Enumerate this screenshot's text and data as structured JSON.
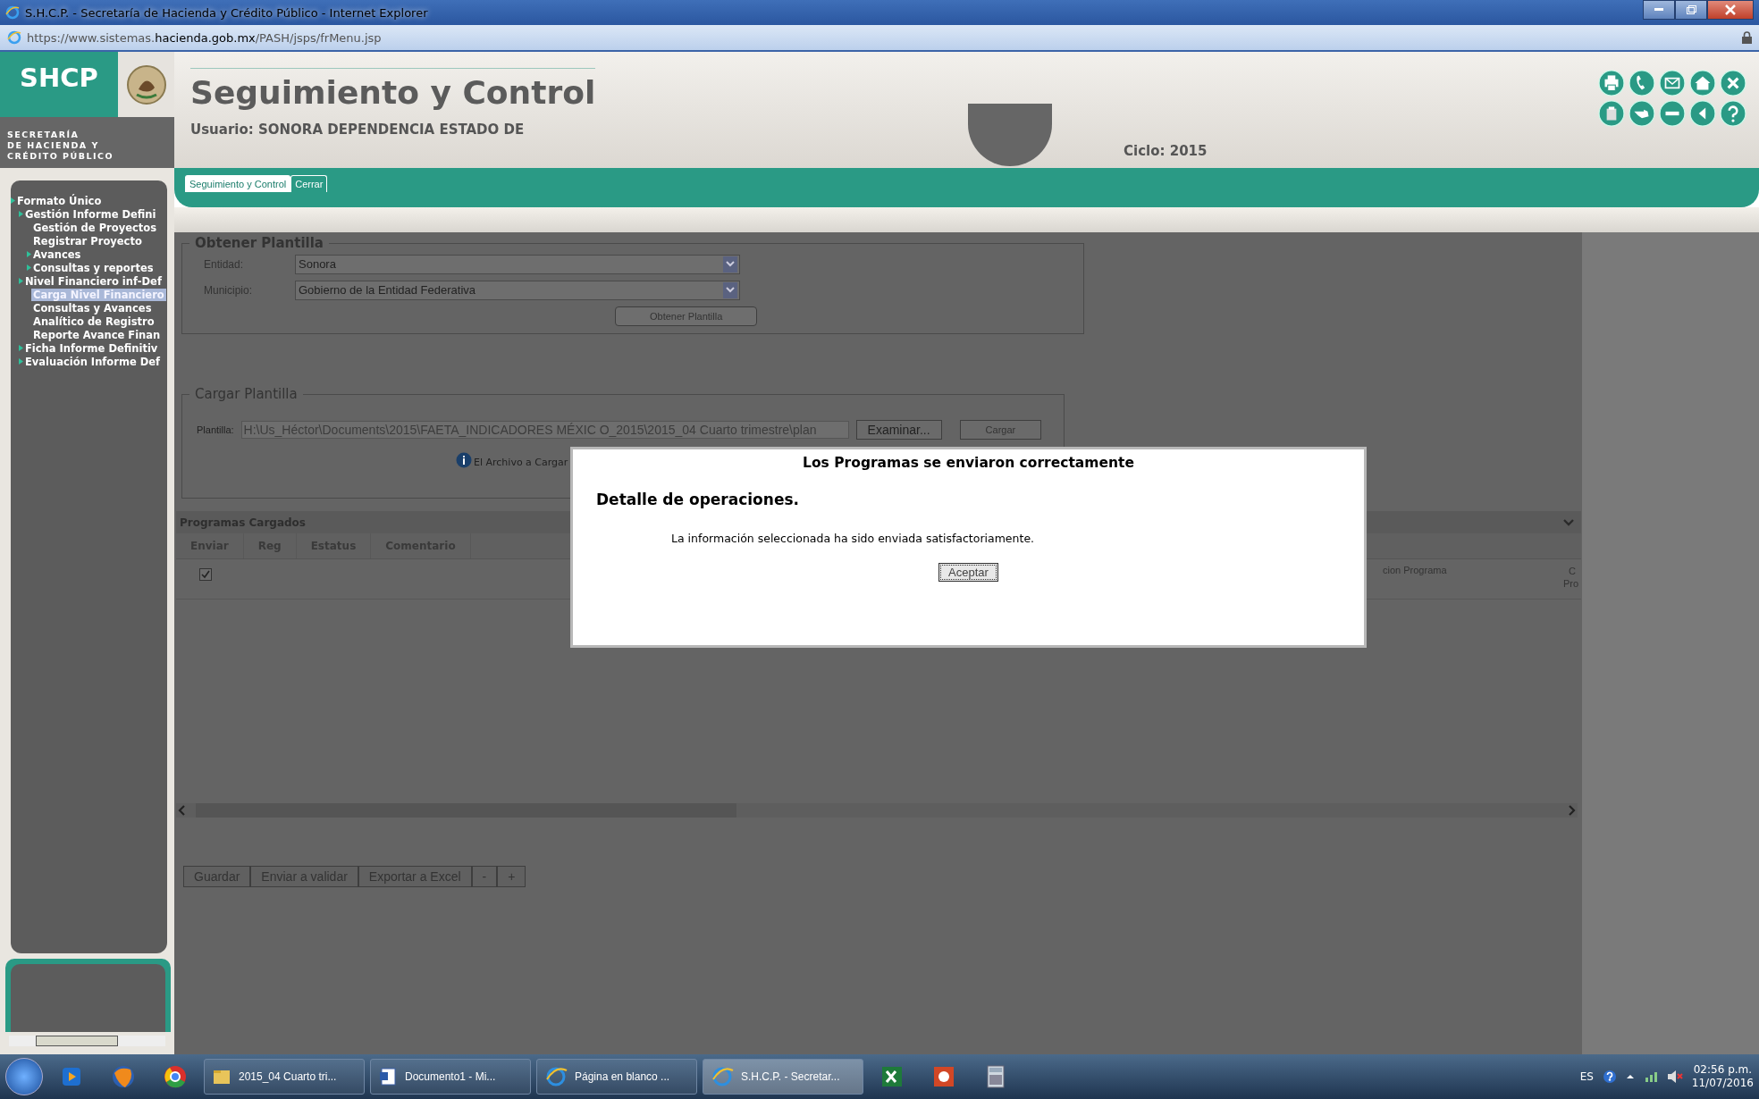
{
  "window": {
    "title": "S.H.C.P. - Secretaría de Hacienda y Crédito Público - Internet Explorer"
  },
  "address_bar": {
    "url": "https://www.sistemas.**hacienda.gob.mx**/PASH/jsps/frMenu.jsp"
  },
  "logo": {
    "acronym": "SHCP",
    "subtitle_lines": [
      "SECRETARÍA",
      "DE HACIENDA Y",
      "CRÉDITO PÚBLICO"
    ]
  },
  "header": {
    "title": "Seguimiento y Control",
    "user": "Usuario: SONORA DEPENDENCIA ESTADO DE",
    "cycle": "Ciclo: 2015"
  },
  "tabs": [
    {
      "label": "Seguimiento y Control",
      "selected": true
    },
    {
      "label": "Cerrar",
      "selected": false
    }
  ],
  "sidebar": {
    "items": [
      {
        "label": "Formato Único",
        "kind": "folder",
        "selected": false,
        "children": [
          {
            "label": "Gestión Informe Defini",
            "kind": "folder",
            "selected": false,
            "children": [
              {
                "label": "Gestión de Proyectos",
                "kind": "page",
                "selected": false
              },
              {
                "label": "Registrar Proyecto",
                "kind": "page",
                "selected": false
              },
              {
                "label": "Avances",
                "kind": "folder",
                "selected": false
              },
              {
                "label": "Consultas y reportes",
                "kind": "folder",
                "selected": false
              }
            ]
          },
          {
            "label": "Nivel Financiero inf-Def",
            "kind": "folder",
            "selected": false,
            "children": [
              {
                "label": "Carga Nivel Financiero",
                "kind": "page",
                "selected": true
              },
              {
                "label": "Consultas y Avances",
                "kind": "page",
                "selected": false
              },
              {
                "label": "Analítico de Registro",
                "kind": "page",
                "selected": false
              },
              {
                "label": "Reporte Avance Finan",
                "kind": "page",
                "selected": false
              }
            ]
          },
          {
            "label": "Ficha Informe Definitiv",
            "kind": "folder",
            "selected": false
          },
          {
            "label": "Evaluación Informe Def",
            "kind": "folder",
            "selected": false
          }
        ]
      }
    ]
  },
  "obtain_template": {
    "legend": "Obtener Plantilla",
    "fields": [
      {
        "label": "Entidad:",
        "value": "Sonora"
      },
      {
        "label": "Municipio:",
        "value": "Gobierno de la Entidad Federativa"
      }
    ],
    "button": "Obtener Plantilla"
  },
  "load_template": {
    "legend": "Cargar Plantilla",
    "label": "Plantilla:",
    "value": "H:\\Us_Héctor\\Documents\\2015\\FAETA_INDICADORES MÉXIC O_2015\\2015_04 Cuarto trimestre\\plan",
    "browse_button": "Examinar...",
    "load_button": "Cargar",
    "info": "El Archivo a Cargar"
  },
  "programs_table": {
    "title": "Programas Cargados",
    "columns": [
      "Enviar",
      "Reg",
      "Estatus",
      "Comentario"
    ],
    "right_columns": [
      "cion Programa",
      "C Pro"
    ],
    "rows": [
      {
        "checked": true
      }
    ]
  },
  "actions": [
    "Guardar",
    "Enviar a validar",
    "Exportar a Excel",
    "-",
    "+"
  ],
  "dialog": {
    "title": "Los Programas se enviaron correctamente",
    "heading": "Detalle de operaciones.",
    "message": "La información seleccionada ha sido enviada satisfactoriamente.",
    "button": "Aceptar"
  },
  "taskbar": {
    "tasks": [
      {
        "label": "2015_04 Cuarto tri...",
        "selected": false
      },
      {
        "label": "Documento1 - Mi...",
        "selected": false
      },
      {
        "label": "Página en blanco ...",
        "selected": false
      },
      {
        "label": "S.H.C.P. - Secretar...",
        "selected": true
      }
    ],
    "language": "ES",
    "time": "02:56 p.m.",
    "date": "11/07/2016"
  }
}
